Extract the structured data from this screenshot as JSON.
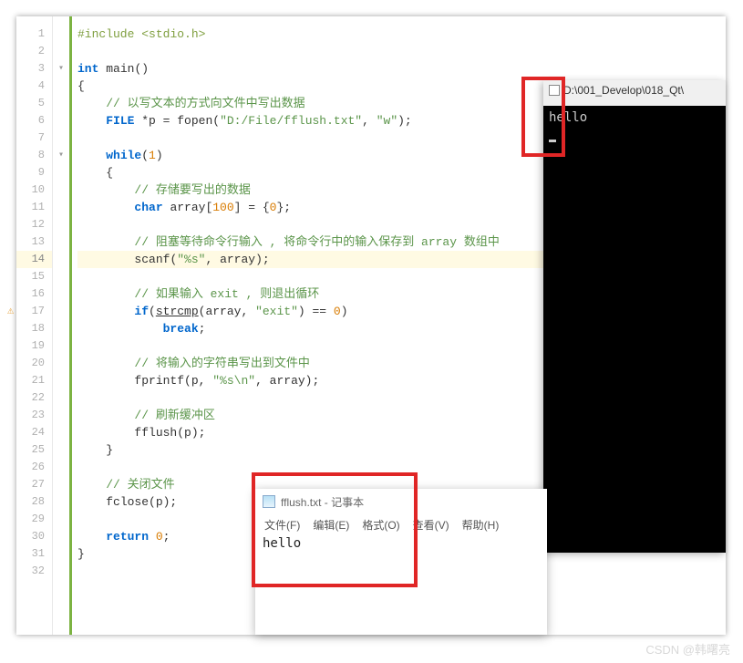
{
  "code": {
    "lines": [
      {
        "n": 1,
        "html": "<span class='pp'>#include</span> <span class='pp'>&lt;stdio.h&gt;</span>"
      },
      {
        "n": 2,
        "html": ""
      },
      {
        "n": 3,
        "html": "<span class='kw'>int</span> <span class='fn'>main</span>()",
        "fold": true
      },
      {
        "n": 4,
        "html": "{"
      },
      {
        "n": 5,
        "html": "    <span class='cmt'>// 以写文本的方式向文件中写出数据</span>"
      },
      {
        "n": 6,
        "html": "    <span class='kw'>FILE</span> *p = <span class='fn'>fopen</span>(<span class='str'>\"D:/File/fflush.txt\"</span>, <span class='str'>\"w\"</span>);"
      },
      {
        "n": 7,
        "html": ""
      },
      {
        "n": 8,
        "html": "    <span class='kw'>while</span>(<span class='num'>1</span>)",
        "fold": true
      },
      {
        "n": 9,
        "html": "    {"
      },
      {
        "n": 10,
        "html": "        <span class='cmt'>// 存储要写出的数据</span>"
      },
      {
        "n": 11,
        "html": "        <span class='kw'>char</span> array[<span class='num'>100</span>] = {<span class='num'>0</span>};"
      },
      {
        "n": 12,
        "html": ""
      },
      {
        "n": 13,
        "html": "        <span class='cmt'>// 阻塞等待命令行输入 , 将命令行中的输入保存到 array 数组中</span>"
      },
      {
        "n": 14,
        "html": "        <span class='fn'>scanf</span>(<span class='str'>\"%s\"</span>, array);",
        "current": true
      },
      {
        "n": 15,
        "html": ""
      },
      {
        "n": 16,
        "html": "        <span class='cmt'>// 如果输入 exit , 则退出循环</span>"
      },
      {
        "n": 17,
        "html": "        <span class='kw'>if</span>(<span class='fn u'>strcmp</span>(array, <span class='str'>\"exit\"</span>) == <span class='num'>0</span>)",
        "warn": true
      },
      {
        "n": 18,
        "html": "            <span class='kw'>break</span>;"
      },
      {
        "n": 19,
        "html": ""
      },
      {
        "n": 20,
        "html": "        <span class='cmt'>// 将输入的字符串写出到文件中</span>"
      },
      {
        "n": 21,
        "html": "        <span class='fn'>fprintf</span>(p, <span class='str'>\"%s\\n\"</span>, array);"
      },
      {
        "n": 22,
        "html": ""
      },
      {
        "n": 23,
        "html": "        <span class='cmt'>// 刷新缓冲区</span>"
      },
      {
        "n": 24,
        "html": "        <span class='fn'>fflush</span>(p);"
      },
      {
        "n": 25,
        "html": "    }"
      },
      {
        "n": 26,
        "html": ""
      },
      {
        "n": 27,
        "html": "    <span class='cmt'>// 关闭文件</span>"
      },
      {
        "n": 28,
        "html": "    <span class='fn'>fclose</span>(p);"
      },
      {
        "n": 29,
        "html": ""
      },
      {
        "n": 30,
        "html": "    <span class='kw'>return</span> <span class='num'>0</span>;"
      },
      {
        "n": 31,
        "html": "}"
      },
      {
        "n": 32,
        "html": ""
      }
    ]
  },
  "console": {
    "title": "D:\\001_Develop\\018_Qt\\",
    "output": "hello"
  },
  "notepad": {
    "title": "fflush.txt - 记事本",
    "menu": [
      "文件(F)",
      "编辑(E)",
      "格式(O)",
      "查看(V)",
      "帮助(H)"
    ],
    "content": "hello"
  },
  "watermark": "CSDN @韩曙亮"
}
